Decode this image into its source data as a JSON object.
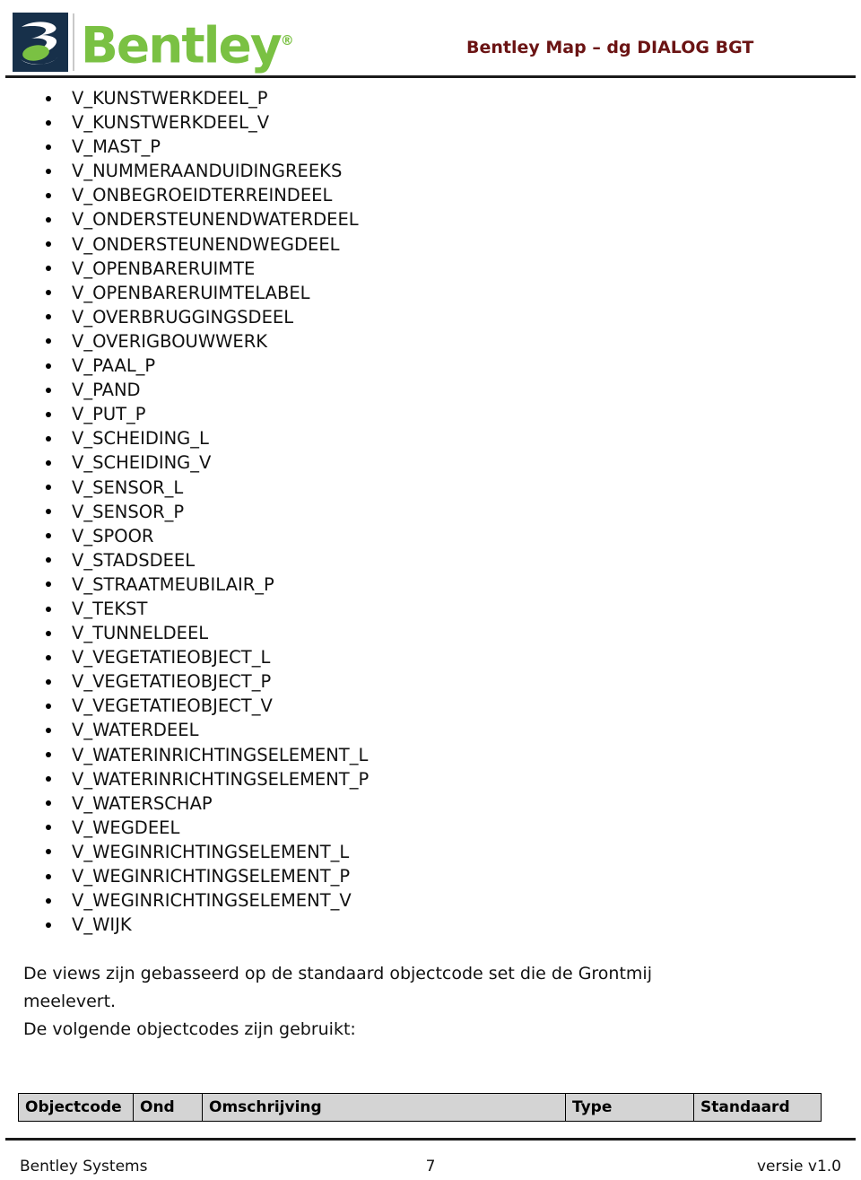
{
  "header": {
    "logo_text": "Bentley",
    "logo_registered_mark": "®",
    "logo_icon_name": "bentley-b-logo",
    "title": "Bentley Map – dg DIALOG BGT",
    "title_color": "#6b1414",
    "brand_green": "#7ac143",
    "brand_navy": "#17304a"
  },
  "content": {
    "view_list": [
      "V_KUNSTWERKDEEL_P",
      "V_KUNSTWERKDEEL_V",
      "V_MAST_P",
      "V_NUMMERAANDUIDINGREEKS",
      "V_ONBEGROEIDTERREINDEEL",
      "V_ONDERSTEUNENDWATERDEEL",
      "V_ONDERSTEUNENDWEGDEEL",
      "V_OPENBARERUIMTE",
      "V_OPENBARERUIMTELABEL",
      "V_OVERBRUGGINGSDEEL",
      "V_OVERIGBOUWWERK",
      "V_PAAL_P",
      "V_PAND",
      "V_PUT_P",
      "V_SCHEIDING_L",
      "V_SCHEIDING_V",
      "V_SENSOR_L",
      "V_SENSOR_P",
      "V_SPOOR",
      "V_STADSDEEL",
      "V_STRAATMEUBILAIR_P",
      "V_TEKST",
      "V_TUNNELDEEL",
      "V_VEGETATIEOBJECT_L",
      "V_VEGETATIEOBJECT_P",
      "V_VEGETATIEOBJECT_V",
      "V_WATERDEEL",
      "V_WATERINRICHTINGSELEMENT_L",
      "V_WATERINRICHTINGSELEMENT_P",
      "V_WATERSCHAP",
      "V_WEGDEEL",
      "V_WEGINRICHTINGSELEMENT_L",
      "V_WEGINRICHTINGSELEMENT_P",
      "V_WEGINRICHTINGSELEMENT_V",
      "V_WIJK"
    ],
    "paragraph_lines": [
      "De views zijn gebasseerd op de standaard objectcode set die de Grontmij",
      "meelevert.",
      "De volgende objectcodes zijn gebruikt:"
    ]
  },
  "table": {
    "headers": [
      "Objectcode",
      "Ond",
      "Omschrijving",
      "Type",
      "Standaard"
    ],
    "header_background": "#d4d4d4",
    "rows": []
  },
  "footer": {
    "left": "Bentley Systems",
    "page_number": "7",
    "right": "versie v1.0"
  }
}
